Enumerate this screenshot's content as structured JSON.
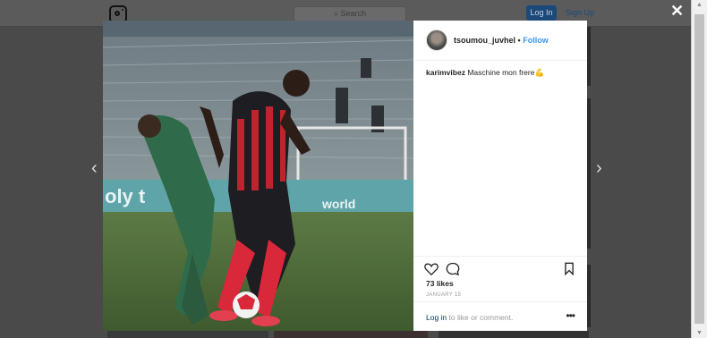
{
  "background": {
    "search_placeholder": "Search",
    "login_label": "Log In",
    "signup_label": "Sign Up"
  },
  "modal": {
    "close_label": "✕",
    "prev_label": "‹",
    "next_label": "›",
    "author": {
      "username": "tsoumou_juvhel",
      "separator": "•",
      "follow_label": "Follow"
    },
    "caption": {
      "username": "karimvibez",
      "text": "Maschine mon frere💪"
    },
    "likes": "73 likes",
    "date": "JANUARY 15",
    "login_prompt": {
      "link": "Log in",
      "rest": "to like or comment."
    },
    "more_label": "•••"
  },
  "colors": {
    "accent": "#3897f0",
    "overlay": "#4a4a4a"
  },
  "icons": [
    "instagram-logo",
    "close-icon",
    "chevron-left-icon",
    "chevron-right-icon",
    "heart-icon",
    "comment-icon",
    "bookmark-icon",
    "more-icon"
  ]
}
